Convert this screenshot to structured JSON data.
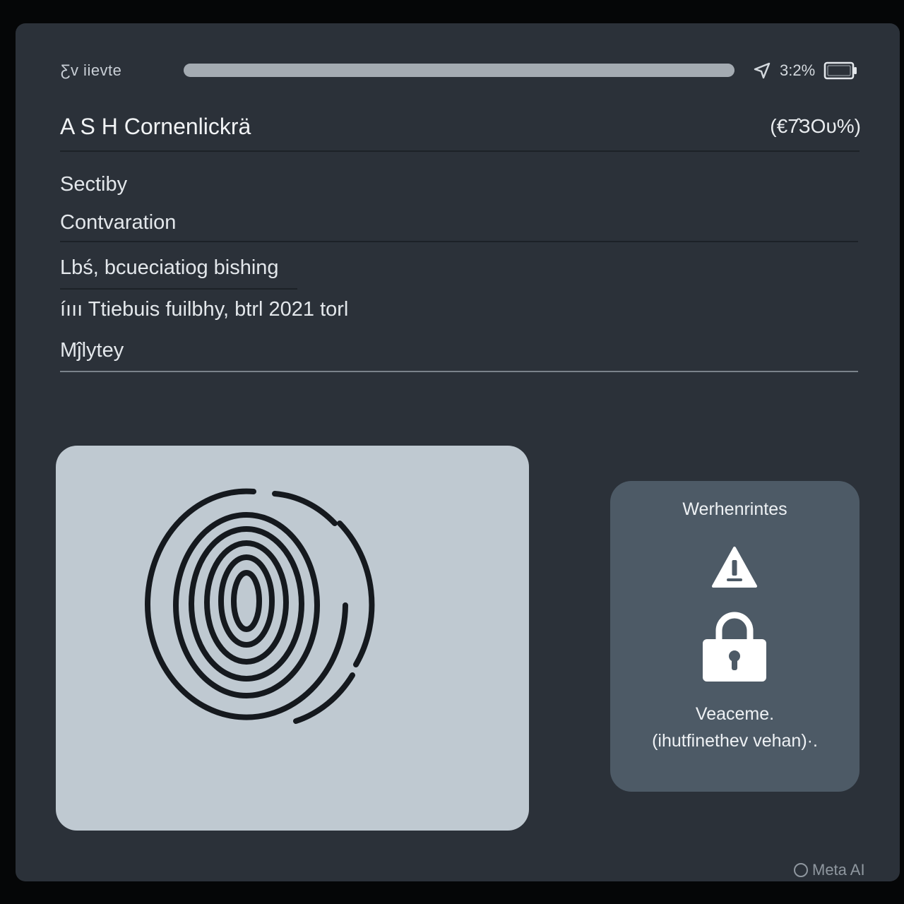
{
  "status_bar": {
    "carrier": "Ƹv iievte",
    "progress": 1.0,
    "battery_text": "3:2%"
  },
  "header": {
    "title": "A S H Cornenlickrä",
    "meta": "(€7̂ЗΟυ%)"
  },
  "menu": {
    "items": [
      {
        "label": "Sectiby"
      },
      {
        "label": "Contvaration"
      },
      {
        "label": "Lbś, bcueciatiog bishing"
      },
      {
        "label": "íııı Ttiebuis fuilbhy, btrl 2021 torl"
      },
      {
        "label": "Mĵlytey"
      }
    ]
  },
  "fingerprint": {
    "icon": "fingerprint-icon"
  },
  "alert": {
    "title": "Werhenrintes",
    "warning_icon": "warning-triangle-icon",
    "lock_icon": "padlock-icon",
    "message": "Veaceme.",
    "submessage": "(ihutfinethev vehan)·."
  },
  "watermark": {
    "text": "Meta AI"
  },
  "colors": {
    "background": "#050607",
    "panel": "#2b3139",
    "card_light": "#bfc9d1",
    "card_dark": "#4d5a66",
    "text": "#e3e7eb"
  }
}
